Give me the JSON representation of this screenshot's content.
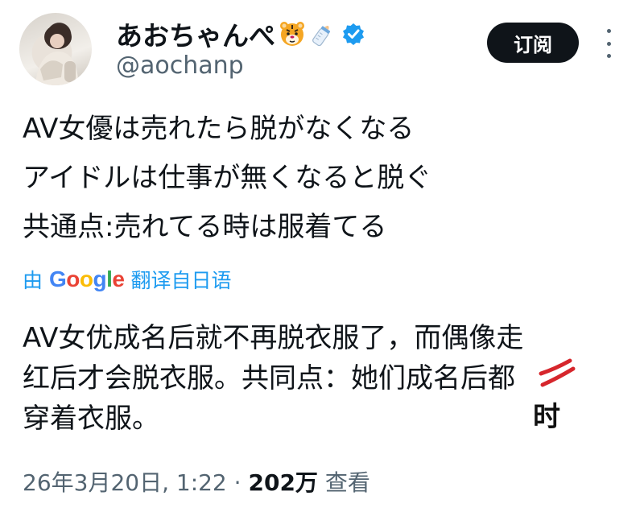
{
  "author": {
    "display_name": "あおちゃんぺ",
    "handle": "@aochanp",
    "emoji": [
      "tiger-face-emoji",
      "baby-bottle-emoji"
    ],
    "verified": true
  },
  "actions": {
    "subscribe_label": "订阅"
  },
  "tweet": {
    "lines": [
      "AV女優は売れたら脱がなくなる",
      "アイドルは仕事が無くなると脱ぐ",
      "共通点:売れてる時は服着てる"
    ]
  },
  "translation": {
    "prefix": "由",
    "provider": "Google",
    "suffix": "翻译自日语",
    "lines": [
      "AV女优成名后就不再脱衣服了，而偶像走",
      "红后才会脱衣服。共同点：她们成名后都",
      "穿着衣服。"
    ],
    "handwritten_correction": "时"
  },
  "meta": {
    "date": "26年3月20日, 1:22",
    "separator": "·",
    "views": "202万",
    "views_suffix": "查看"
  },
  "colors": {
    "accent": "#1d9bf0",
    "text": "#0f1419",
    "muted": "#536471",
    "annotation_red": "#d6262c"
  }
}
